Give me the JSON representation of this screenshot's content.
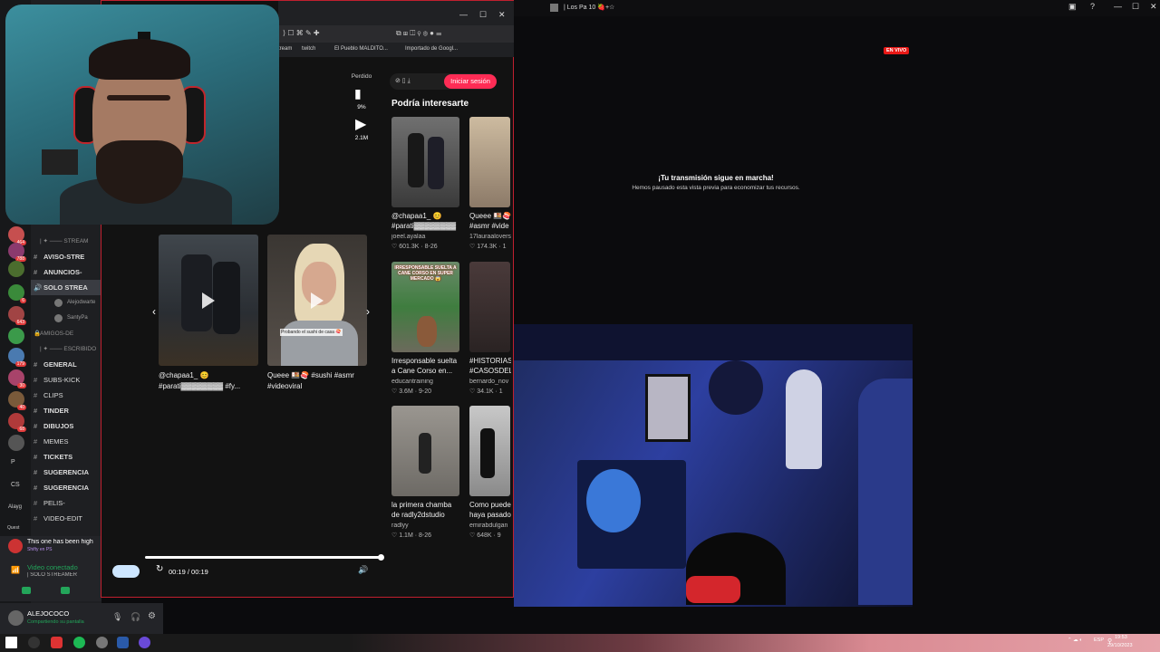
{
  "discord": {
    "channels": [
      {
        "label": "| ✦ ─── STREAM",
        "type": "cat"
      },
      {
        "label": "AVISO-STRE",
        "type": "bold"
      },
      {
        "label": "ANUNCIOS-",
        "type": "bold"
      },
      {
        "label": "SOLO STREA",
        "type": "bold"
      },
      {
        "label": "Alejodwarte",
        "type": "sub"
      },
      {
        "label": "SantyPa",
        "type": "sub"
      },
      {
        "label": "AMIGOS-DE",
        "type": "cat"
      },
      {
        "label": "| ✦ ─── ESCRIBIDO",
        "type": "cat"
      },
      {
        "label": "GENERAL",
        "type": "bold"
      },
      {
        "label": "SUBS-KICK",
        "type": "plain"
      },
      {
        "label": "CLIPS",
        "type": "plain"
      },
      {
        "label": "TINDER",
        "type": "bold"
      },
      {
        "label": "DIBUJOS",
        "type": "bold"
      },
      {
        "label": "MEMES",
        "type": "plain"
      },
      {
        "label": "TICKETS",
        "type": "bold"
      },
      {
        "label": "SUGERENCIA",
        "type": "bold"
      },
      {
        "label": "SUGERENCIA",
        "type": "bold"
      },
      {
        "label": "PELIS-",
        "type": "plain"
      },
      {
        "label": "VIDEO-EDIT",
        "type": "plain"
      }
    ],
    "left_labels": [
      "P",
      "CS",
      "Alayg",
      "Quest"
    ],
    "notification": {
      "title": "This one has been high",
      "sub": "Shifty en PS"
    },
    "voice": {
      "status": "Video conectado",
      "channel": "| SOLO STREAMER"
    },
    "user": {
      "name": "ALEJOCOCO",
      "status": "Compartiendo su pantalla"
    }
  },
  "browser": {
    "bookmarks": [
      "tream",
      "twitch",
      "El Pueblo MALDITO...",
      "Importado de Googl..."
    ],
    "login_label": "Iniciar sesión",
    "side_title": "Podría interesarte",
    "stats": {
      "likes_pct": "9%",
      "views": "2.1M",
      "top": "Perdido"
    },
    "main_videos": [
      {
        "caption": "@chapaa1_ 😊",
        "caption2": "#parati▓▓▓▓▓▓▓▓ #fy..."
      },
      {
        "caption": "Queee 🍱🍣 #sushi #asmr",
        "caption2": "#videoviral"
      }
    ],
    "recs": [
      {
        "title": "@chapaa1_ 😊",
        "title2": "#parati▓▓▓▓▓▓▓▓",
        "author": "joeel.ayalaa",
        "stats": "♡ 601.3K · 8-26"
      },
      {
        "title": "Queee 🍱🍣",
        "title2": "#asmr #vide",
        "author": "17lauraalovers",
        "stats": "♡ 174.3K · 1"
      },
      {
        "title": "Irresponsable suelta",
        "title2": "a Cane Corso en...",
        "author": "educantraining",
        "stats": "♡ 3.6M · 9-20"
      },
      {
        "title": "#HISTORIAS",
        "title2": "#CASOSDEL",
        "author": "bernardo_nov",
        "stats": "♡ 34.1K · 1"
      },
      {
        "title": "la primera chamba",
        "title2": "de radly2dstudio",
        "author": "radlyy",
        "stats": "♡ 1.1M · 8-26"
      },
      {
        "title": "Como puede",
        "title2": "haya pasado",
        "author": "emirabdulgan",
        "stats": "♡ 648K · 9"
      }
    ],
    "rec_overlay_text": "IRRESPONSABLE SUELTA A CANE CORSO EN SUPER MERCADO 😱",
    "video_overlay_text": "Probando el sushi de casa 🍣",
    "time": "00:19 / 00:19"
  },
  "stream": {
    "window_title": "| Los Pa 10 🍓+☆",
    "live_badge": "EN VIVO",
    "paused_title": "¡Tu transmisión sigue en marcha!",
    "paused_sub": "Hemos pausado esta vista previa para economizar tus recursos."
  },
  "taskbar": {
    "lang": "ESP",
    "time": "19:53",
    "date": "29/10/2023"
  },
  "colors": {
    "accent_red": "#fe2c55",
    "live_red": "#e91916",
    "discord_bg": "#1e1f22"
  }
}
